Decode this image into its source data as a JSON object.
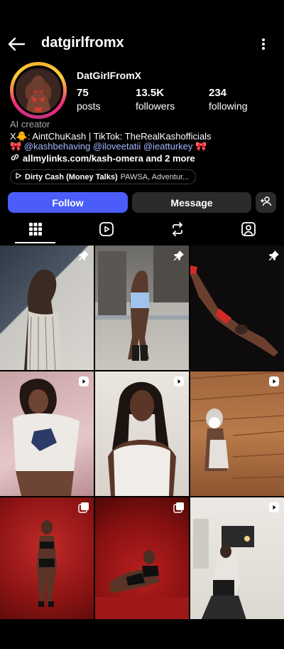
{
  "header": {
    "username": "datgirlfromx"
  },
  "profile": {
    "display_name": "DatGirlFromX",
    "stats": [
      {
        "value": "75",
        "label": "posts"
      },
      {
        "value": "13.5K",
        "label": "followers"
      },
      {
        "value": "234",
        "label": "following"
      }
    ],
    "category": "AI creator",
    "bio_line1": "X🐥: AintChuKash | TikTok: TheRealKashofficials",
    "bio_line2_prefix": "🎀 ",
    "bio_mentions": "@kashbehaving @iloveetatii @ieatturkey",
    "bio_line2_suffix": " 🎀",
    "link_text": "allmylinks.com/kash-omera and 2 more",
    "music": {
      "song": "Dirty Cash (Money Talks)",
      "artist": "PAWSA, Adventur..."
    }
  },
  "actions": {
    "follow_label": "Follow",
    "message_label": "Message"
  },
  "tabs": [
    {
      "icon": "grid-icon",
      "active": true
    },
    {
      "icon": "reels-icon",
      "active": false
    },
    {
      "icon": "reposts-icon",
      "active": false
    },
    {
      "icon": "tagged-icon",
      "active": false
    }
  ],
  "posts": [
    {
      "badge": "pin-icon"
    },
    {
      "badge": "pin-icon"
    },
    {
      "badge": "pin-icon"
    },
    {
      "badge": "reel-icon"
    },
    {
      "badge": "reel-icon"
    },
    {
      "badge": "reel-icon"
    },
    {
      "badge": "carousel-icon"
    },
    {
      "badge": "carousel-icon"
    },
    {
      "badge": "reel-icon"
    }
  ],
  "colors": {
    "accent": "#4a5df9",
    "secondary_button": "#2b2b2e",
    "mention": "#a6b8ff"
  }
}
